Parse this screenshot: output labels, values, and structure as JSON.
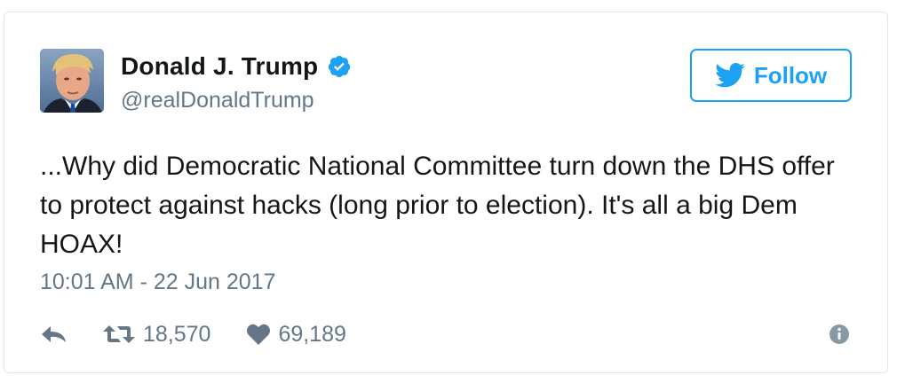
{
  "author": {
    "display_name": "Donald J. Trump",
    "screen_name": "@realDonaldTrump",
    "verified": true,
    "avatar_icon": "profile-photo"
  },
  "follow_button": {
    "label": "Follow",
    "icon": "twitter-bird-icon"
  },
  "tweet": {
    "text": "...Why did Democratic National Committee turn down the DHS offer to protect against hacks (long prior to election). It's all a big Dem HOAX!",
    "timestamp": "10:01 AM - 22 Jun 2017"
  },
  "actions": {
    "reply_icon": "reply-icon",
    "retweet_icon": "retweet-icon",
    "retweet_count": "18,570",
    "like_icon": "heart-icon",
    "like_count": "69,189",
    "info_icon": "info-icon"
  },
  "colors": {
    "twitter_blue": "#1da1f2",
    "text_primary": "#14171a",
    "text_secondary": "#657786",
    "border": "#e1e8ed"
  }
}
